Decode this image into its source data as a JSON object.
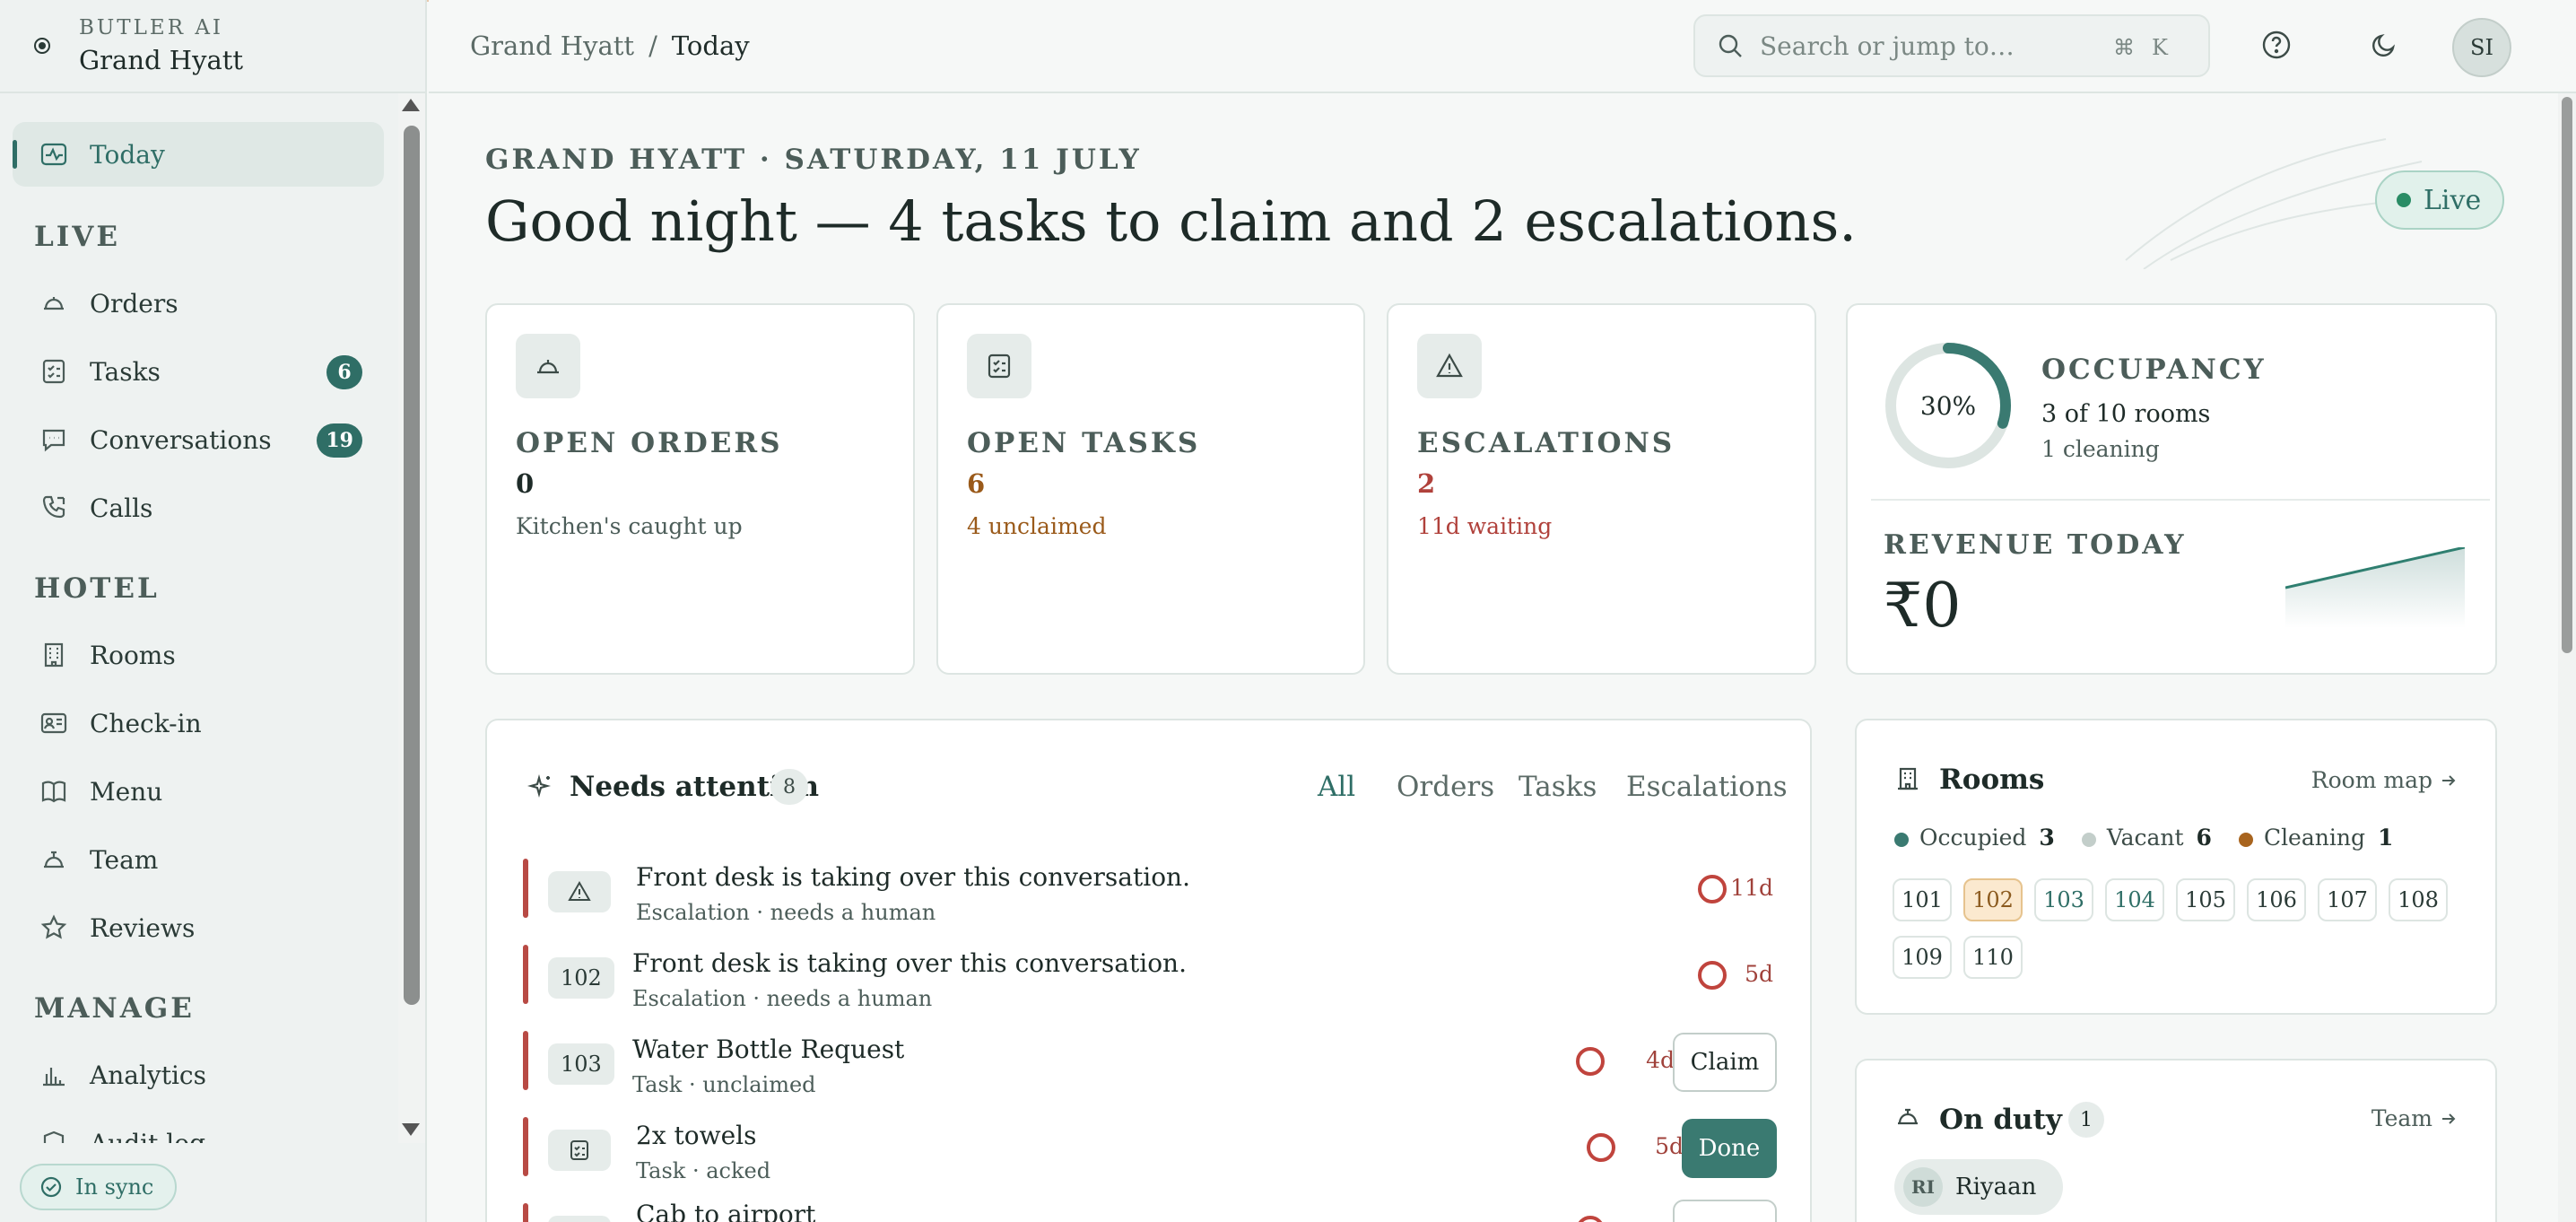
{
  "brand": {
    "product": "BUTLER AI",
    "property": "Grand Hyatt"
  },
  "nav": {
    "today": "Today",
    "sections": {
      "live": "LIVE",
      "hotel": "HOTEL",
      "manage": "MANAGE"
    },
    "live": [
      {
        "label": "Orders",
        "icon": "bell-icon"
      },
      {
        "label": "Tasks",
        "badge": "6",
        "icon": "checklist-icon"
      },
      {
        "label": "Conversations",
        "badge": "19",
        "icon": "chat-icon"
      },
      {
        "label": "Calls",
        "icon": "phone-icon"
      }
    ],
    "hotel": [
      {
        "label": "Rooms",
        "icon": "building-icon"
      },
      {
        "label": "Check-in",
        "icon": "id-card-icon"
      },
      {
        "label": "Menu",
        "icon": "book-icon"
      },
      {
        "label": "Team",
        "icon": "bell-icon"
      },
      {
        "label": "Reviews",
        "icon": "star-icon"
      }
    ],
    "manage": [
      {
        "label": "Analytics",
        "icon": "bar-chart-icon"
      },
      {
        "label": "Audit log",
        "icon": "shield-icon"
      }
    ],
    "sync": "In sync"
  },
  "topbar": {
    "breadcrumb": [
      "Grand Hyatt",
      "/",
      "Today"
    ],
    "search_placeholder": "Search or jump to…",
    "shortcut": [
      "⌘",
      "K"
    ],
    "avatar": "SI"
  },
  "header": {
    "kicker": "GRAND HYATT · SATURDAY, 11 JULY",
    "headline": "Good night — 4 tasks to claim and 2 escalations.",
    "live": "Live"
  },
  "stats": [
    {
      "label": "OPEN ORDERS",
      "value": "0",
      "sub": "Kitchen's caught up",
      "color": "#1e2b28",
      "sub_color": "#4c5d59",
      "icon": "bell-icon"
    },
    {
      "label": "OPEN TASKS",
      "value": "6",
      "sub": "4 unclaimed",
      "color": "#9a5a1a",
      "sub_color": "#9a5a1a",
      "icon": "checklist-icon"
    },
    {
      "label": "ESCALATIONS",
      "value": "2",
      "sub": "11d waiting",
      "color": "#b0413b",
      "sub_color": "#b0413b",
      "icon": "warning-icon"
    }
  ],
  "occupancy": {
    "title": "OCCUPANCY",
    "percent_label": "30%",
    "fraction": 0.3,
    "main": "3 of 10 rooms",
    "sub": "1 cleaning"
  },
  "revenue": {
    "title": "REVENUE TODAY",
    "value": "₹0"
  },
  "attention": {
    "title": "Needs attention",
    "count": "8",
    "tabs": [
      "All",
      "Orders",
      "Tasks",
      "Escalations"
    ],
    "rows": [
      {
        "tag": "",
        "tag_icon": "warning-icon",
        "title": "Front desk is taking over this conversation.",
        "sub": "Escalation · needs a human",
        "age": "11d"
      },
      {
        "tag": "102",
        "title": "Front desk is taking over this conversation.",
        "sub": "Escalation · needs a human",
        "age": "5d"
      },
      {
        "tag": "103",
        "title": "Water Bottle Request",
        "sub": "Task · unclaimed",
        "age": "4d",
        "action": "Claim"
      },
      {
        "tag": "",
        "tag_icon": "checklist-icon",
        "title": "2x towels",
        "sub": "Task · acked",
        "age": "5d",
        "action": "Done"
      },
      {
        "tag": "",
        "tag_icon": "checklist-icon",
        "title": "Cab to airport",
        "sub": "",
        "age": ""
      }
    ]
  },
  "rooms": {
    "title": "Rooms",
    "link": "Room map",
    "legend": [
      {
        "label": "Occupied",
        "count": "3",
        "color": "#3a7a71"
      },
      {
        "label": "Vacant",
        "count": "6",
        "color": "#c3ceca"
      },
      {
        "label": "Cleaning",
        "count": "1",
        "color": "#a8641e"
      }
    ],
    "list": [
      {
        "n": "101",
        "s": "vacant"
      },
      {
        "n": "102",
        "s": "cleaning"
      },
      {
        "n": "103",
        "s": "occupied"
      },
      {
        "n": "104",
        "s": "occupied"
      },
      {
        "n": "105",
        "s": "vacant"
      },
      {
        "n": "106",
        "s": "vacant"
      },
      {
        "n": "107",
        "s": "vacant"
      },
      {
        "n": "108",
        "s": "vacant"
      },
      {
        "n": "109",
        "s": "vacant"
      },
      {
        "n": "110",
        "s": "vacant"
      }
    ]
  },
  "duty": {
    "title": "On duty",
    "count": "1",
    "link": "Team",
    "staff": [
      {
        "initials": "RI",
        "name": "Riyaan"
      }
    ]
  }
}
